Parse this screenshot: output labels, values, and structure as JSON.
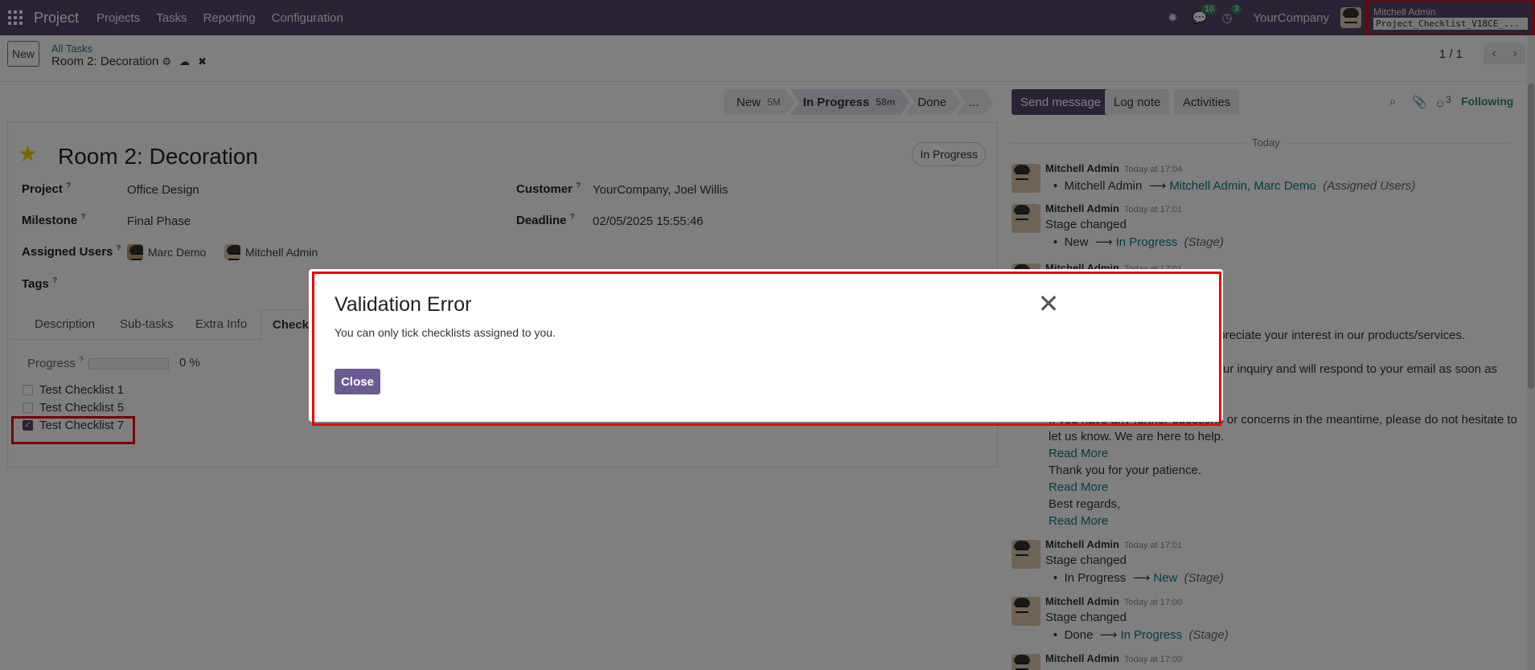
{
  "topbar": {
    "app_name": "Project",
    "menu": [
      "Projects",
      "Tasks",
      "Reporting",
      "Configuration"
    ],
    "messages_count": "10",
    "activities_count": "3",
    "company": "YourCompany",
    "user_name": "Mitchell Admin",
    "database": "Project_Checklist_V18CE_..."
  },
  "control_panel": {
    "new_label": "New",
    "breadcrumb_parent": "All Tasks",
    "record_name": "Room 2: Decoration",
    "pager": "1 / 1"
  },
  "statusbar": [
    {
      "label": "New",
      "duration": "5M"
    },
    {
      "label": "In Progress",
      "duration": "58m"
    },
    {
      "label": "Done",
      "duration": ""
    },
    {
      "label": "...",
      "duration": ""
    }
  ],
  "task": {
    "title": "Room 2: Decoration",
    "state_badge": "In Progress",
    "fields": {
      "project_label": "Project",
      "project": "Office Design",
      "milestone_label": "Milestone",
      "milestone": "Final Phase",
      "assigned_label": "Assigned Users",
      "assigned_users": [
        "Marc Demo",
        "Mitchell Admin"
      ],
      "tags_label": "Tags",
      "customer_label": "Customer",
      "customer": "YourCompany, Joel Willis",
      "deadline_label": "Deadline",
      "deadline": "02/05/2025 15:55:46",
      "help": "?"
    },
    "tabs": [
      "Description",
      "Sub-tasks",
      "Extra Info",
      "Checkli"
    ],
    "progress_label": "Progress",
    "progress_value": "0 %",
    "progress_fraction": 0,
    "checklists": [
      {
        "label": "Test Checklist 1",
        "checked": false
      },
      {
        "label": "Test Checklist 5",
        "checked": false
      },
      {
        "label": "Test Checklist 7",
        "checked": true
      }
    ]
  },
  "chatter": {
    "send_message": "Send message",
    "log_note": "Log note",
    "activities": "Activities",
    "followers_count": "3",
    "following": "Following",
    "today": "Today",
    "messages": [
      {
        "author": "Mitchell Admin",
        "time": "Today at 17:04",
        "body": "",
        "from": "Mitchell Admin",
        "to": "Mitchell Admin, Marc Demo",
        "field": "(Assigned Users)"
      },
      {
        "author": "Mitchell Admin",
        "time": "Today at 17:01",
        "body": "Stage changed",
        "from": "New",
        "to": "In Progress",
        "field": "(Stage)"
      },
      {
        "author": "Mitchell Admin",
        "time": "Today at 17:01",
        "body": "",
        "from": "",
        "to": "",
        "field": ""
      },
      {
        "author": "Mitchell Admin",
        "time": "Today at 17:01",
        "body": "Stage changed",
        "from": "In Progress",
        "to": "New",
        "field": "(Stage)"
      },
      {
        "author": "Mitchell Admin",
        "time": "Today at 17:00",
        "body": "Stage changed",
        "from": "Done",
        "to": "In Progress",
        "field": "(Stage)"
      },
      {
        "author": "Mitchell Admin",
        "time": "Today at 17:00",
        "body": "",
        "from": "",
        "to": "",
        "field": ""
      }
    ],
    "email_lines": [
      "ppreciate your interest in our products/services.",
      "ur inquiry and will respond to your email as soon as",
      "If you have any further questions or concerns in the meantime, please do not hesitate to",
      "let us know. We are here to help.",
      "Read More",
      "Thank you for your patience.",
      "Read More",
      "Best regards,",
      "Read More"
    ]
  },
  "dialog": {
    "title": "Validation Error",
    "message": "You can only tick checklists assigned to you.",
    "close_label": "Close"
  }
}
